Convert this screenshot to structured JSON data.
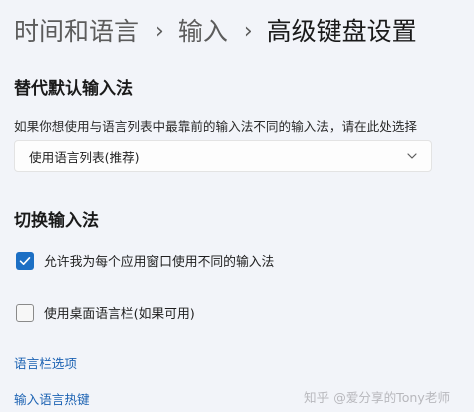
{
  "breadcrumb": {
    "items": [
      "时间和语言",
      "输入",
      "高级键盘设置"
    ],
    "separator": "›"
  },
  "override_input": {
    "title": "替代默认输入法",
    "description": "如果你想使用与语言列表中最靠前的输入法不同的输入法，请在此处选择",
    "dropdown_value": "使用语言列表(推荐)",
    "dropdown_icon": "chevron-down-icon"
  },
  "switching": {
    "title": "切换输入法",
    "per_app_label": "允许我为每个应用窗口使用不同的输入法",
    "per_app_checked": true,
    "language_bar_label": "使用桌面语言栏(如果可用)",
    "language_bar_checked": false
  },
  "links": {
    "language_bar_options": "语言栏选项",
    "input_hotkeys": "输入语言热键"
  },
  "watermark": {
    "text": "知乎 @爱分享的Tony老师"
  },
  "colors": {
    "background": "#f2f4f9",
    "accent": "#1c6fc4",
    "link": "#1d63b3"
  }
}
